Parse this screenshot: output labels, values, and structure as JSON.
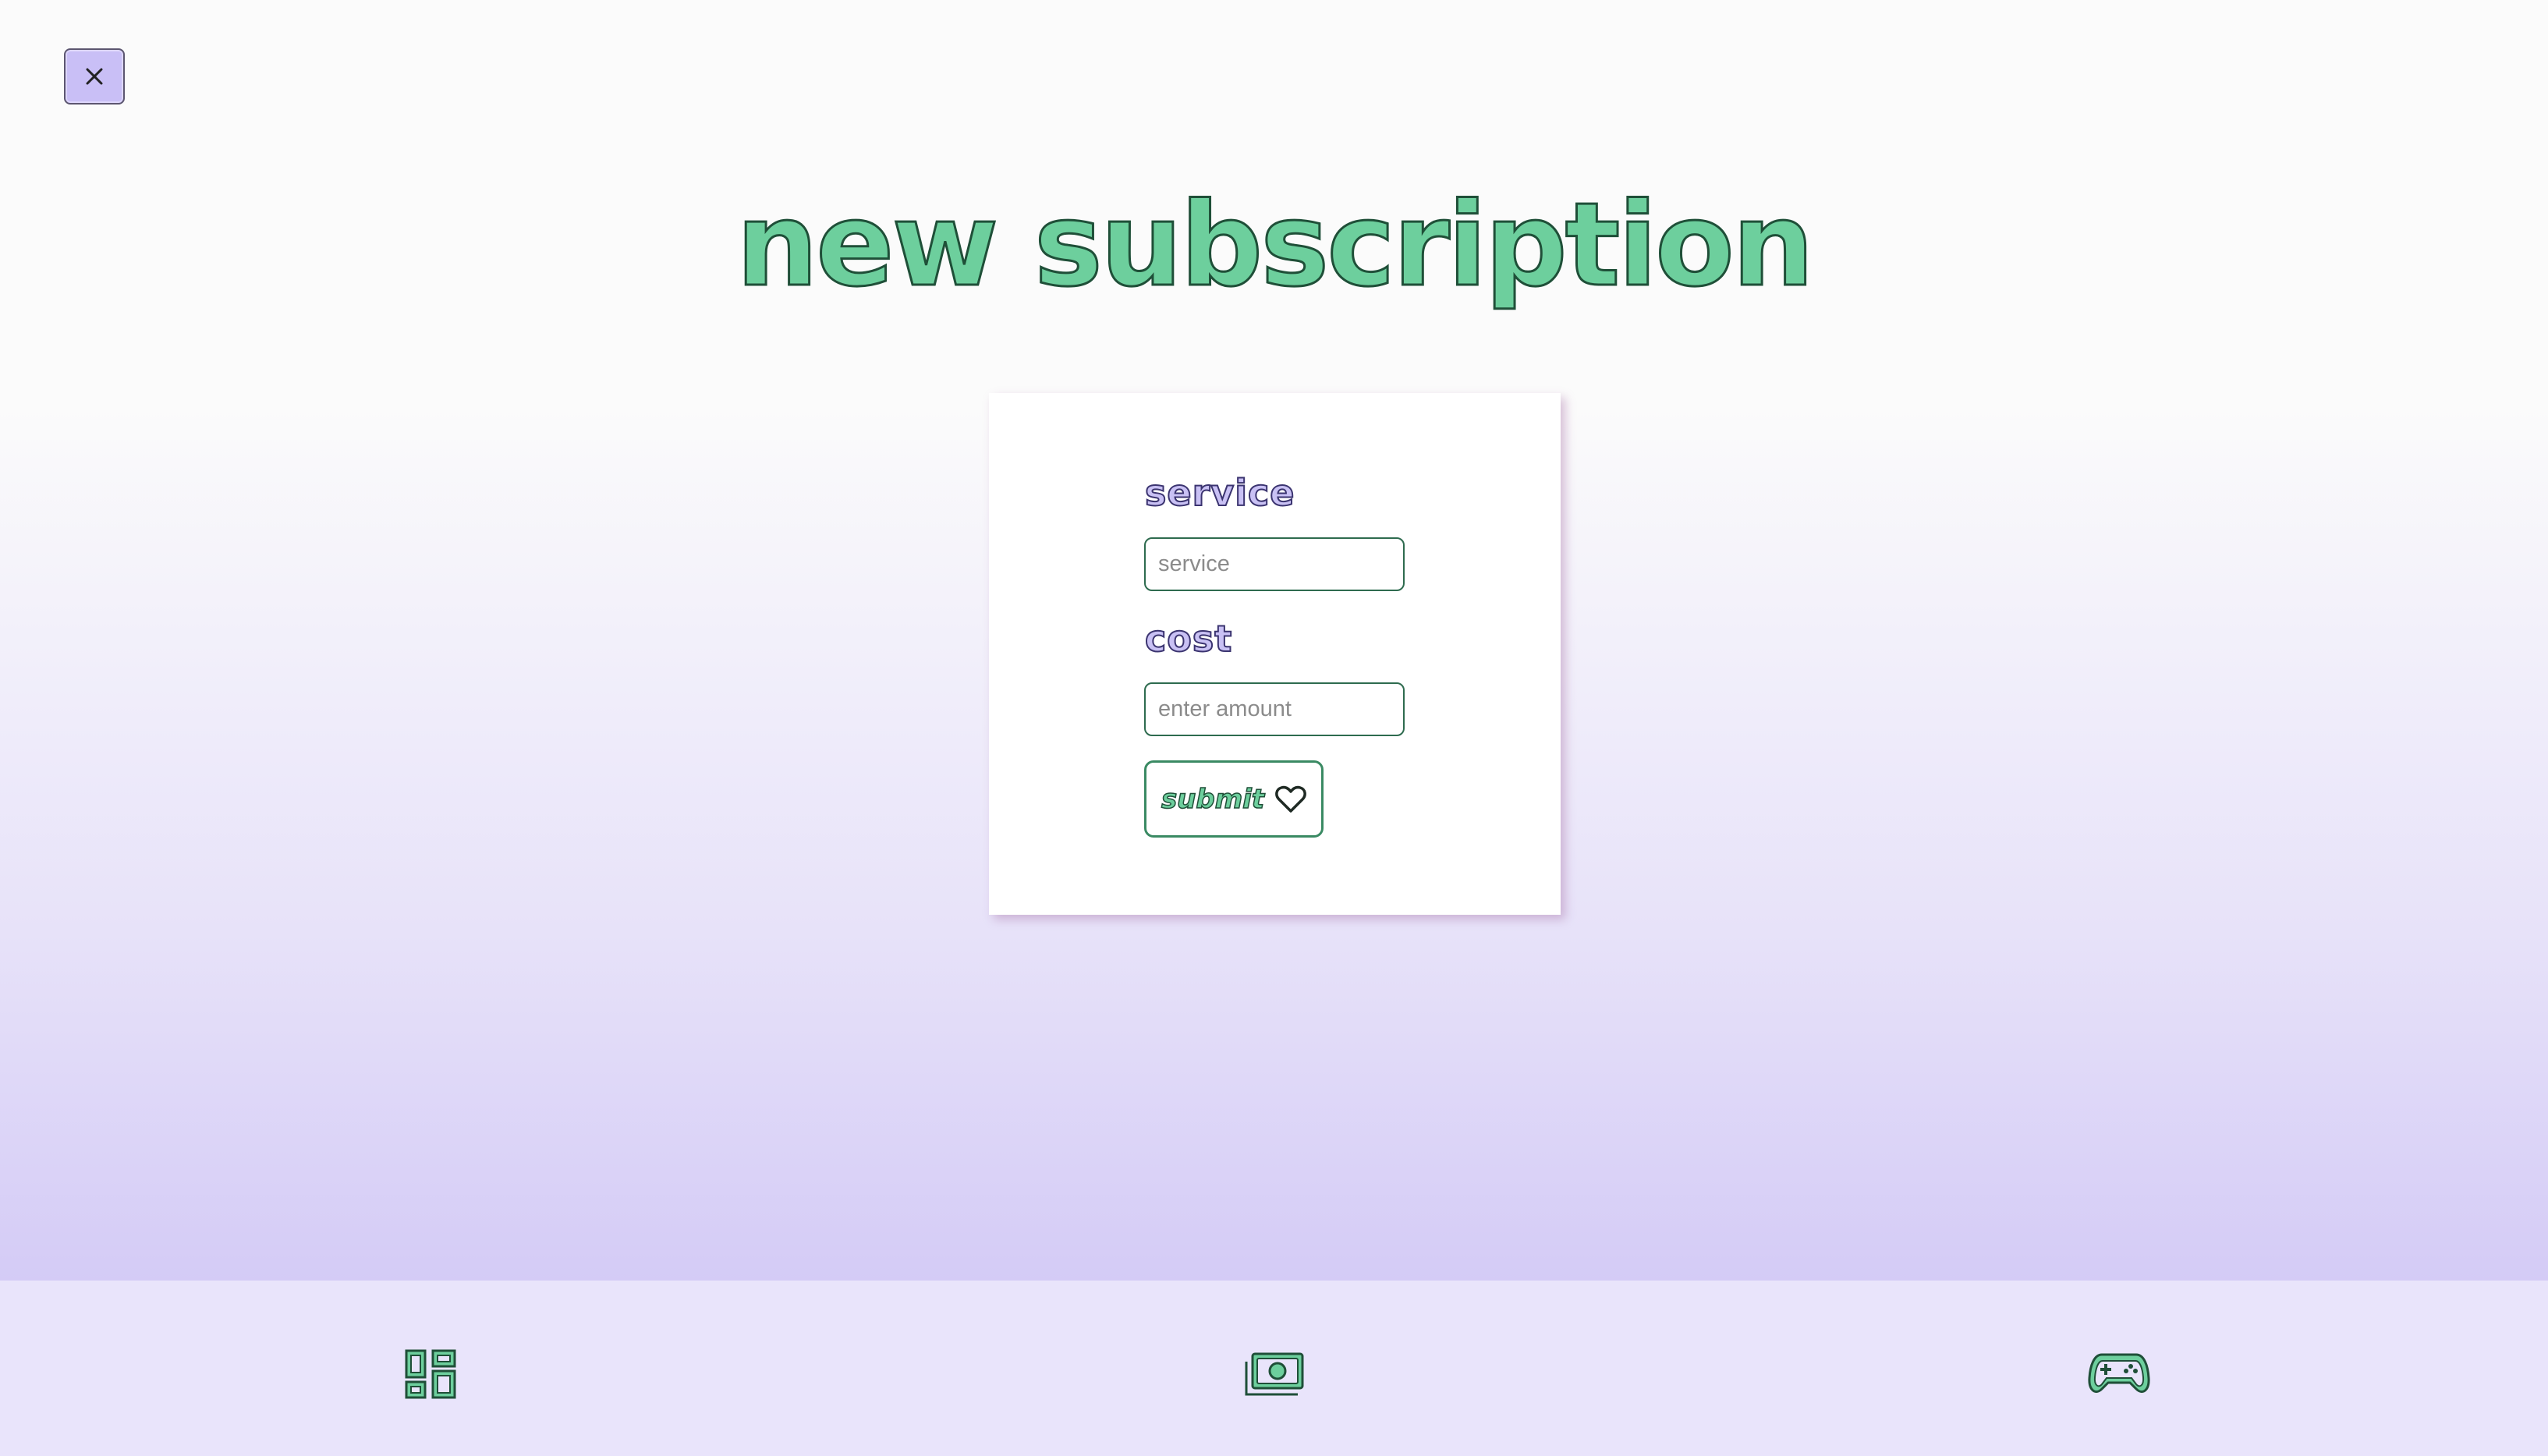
{
  "window": {
    "close_icon": "close-icon"
  },
  "header": {
    "title": "new subscription"
  },
  "form": {
    "service": {
      "label": "service",
      "placeholder": "service",
      "value": ""
    },
    "cost": {
      "label": "cost",
      "placeholder": "enter amount",
      "value": ""
    },
    "submit": {
      "label": "submit",
      "icon": "heart-icon"
    }
  },
  "bottom_nav": {
    "items": [
      {
        "icon": "dashboard-icon"
      },
      {
        "icon": "money-icon"
      },
      {
        "icon": "gamepad-icon"
      }
    ]
  },
  "colors": {
    "accent_green": "#6dcf9d",
    "accent_purple": "#c9c1f4",
    "nav_background": "#e9e4fb"
  }
}
